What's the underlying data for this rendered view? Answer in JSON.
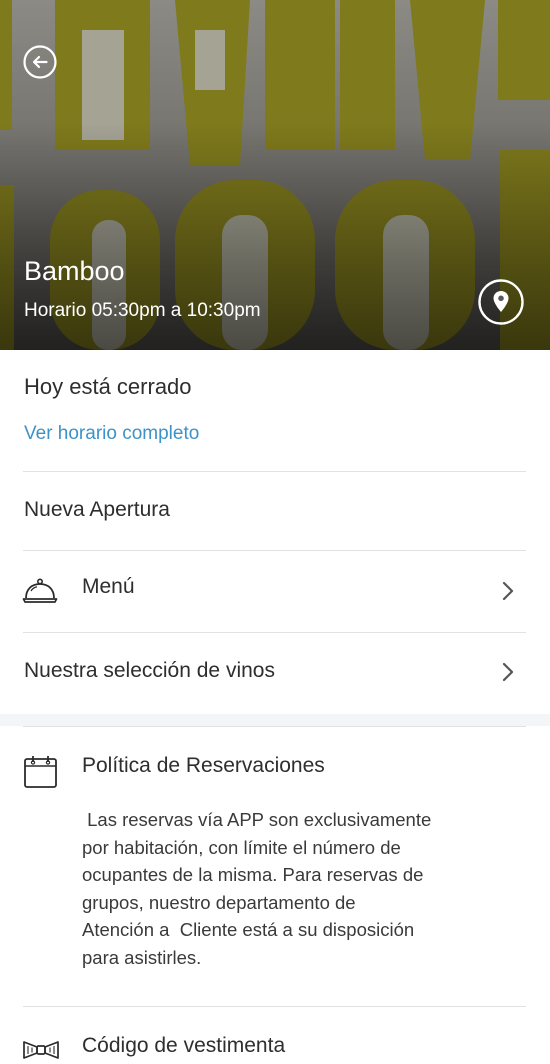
{
  "header": {
    "title": "Bamboo",
    "schedule": "Horario 05:30pm a 10:30pm",
    "back_icon": "back-arrow-icon",
    "location_icon": "location-pin-icon"
  },
  "status": {
    "closed_text": "Hoy está cerrado",
    "schedule_link": "Ver horario completo"
  },
  "items": {
    "nueva_apertura": "Nueva Apertura",
    "menu": "Menú",
    "vinos": "Nuestra selección de vinos"
  },
  "policy": {
    "title": "Política de Reservaciones",
    "body": " Las reservas vía APP son exclusivamente\npor habitación, con límite el número de\nocupantes de la misma. Para reservas de\ngrupos, nuestro departamento de\nAtención a  Cliente está a su disposición\npara asistirles."
  },
  "dress_code": {
    "title": "Código de vestimenta"
  },
  "colors": {
    "accent_link": "#3d93c8",
    "hero_olive": "#7f7a1c"
  }
}
